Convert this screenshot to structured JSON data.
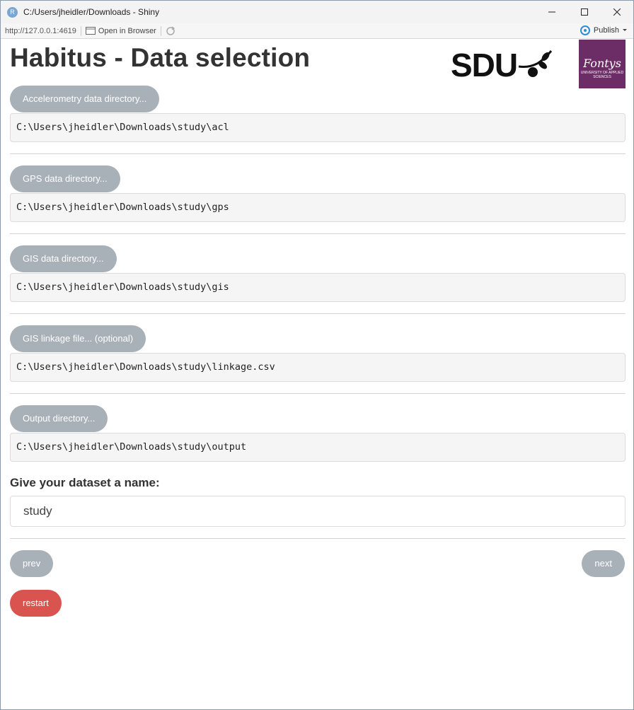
{
  "window": {
    "title": "C:/Users/jheidler/Downloads - Shiny",
    "app_icon_letter": "R"
  },
  "toolbar": {
    "url": "http://127.0.0.1:4619",
    "open_in_browser": "Open in Browser",
    "publish": "Publish"
  },
  "header": {
    "title": "Habitus - Data selection",
    "sdu_logo_text": "SDU",
    "fontys_name": "Fontys",
    "fontys_sub": "UNIVERSITY OF APPLIED SCIENCES"
  },
  "sections": [
    {
      "button_label": "Accelerometry data directory...",
      "path": "C:\\Users\\jheidler\\Downloads\\study\\acl"
    },
    {
      "button_label": "GPS data directory...",
      "path": "C:\\Users\\jheidler\\Downloads\\study\\gps"
    },
    {
      "button_label": "GIS data directory...",
      "path": "C:\\Users\\jheidler\\Downloads\\study\\gis"
    },
    {
      "button_label": "GIS linkage file... (optional)",
      "path": "C:\\Users\\jheidler\\Downloads\\study\\linkage.csv"
    },
    {
      "button_label": "Output directory...",
      "path": "C:\\Users\\jheidler\\Downloads\\study\\output"
    }
  ],
  "dataset_name": {
    "label": "Give your dataset a name:",
    "value": "study"
  },
  "nav": {
    "prev": "prev",
    "next": "next",
    "restart": "restart"
  },
  "colors": {
    "button_grey": "#a8b0b8",
    "restart_red": "#d9534f",
    "fontys_purple": "#6c2c65"
  }
}
